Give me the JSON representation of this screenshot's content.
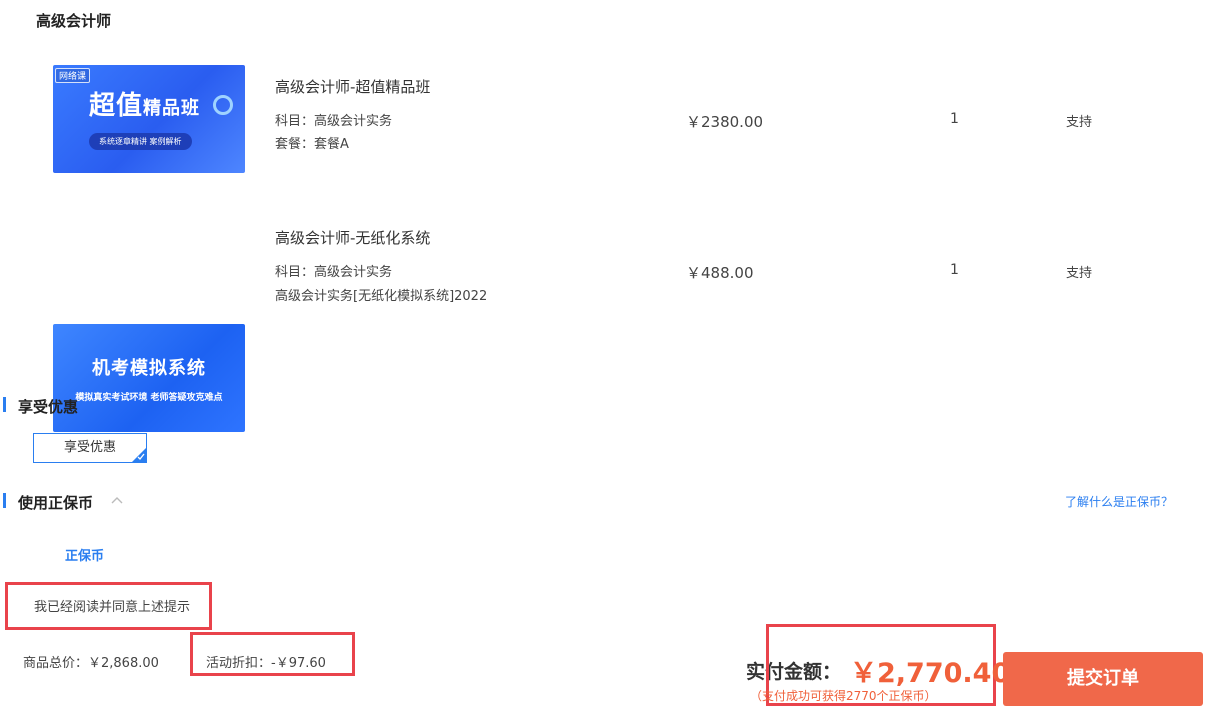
{
  "category": {
    "title": "高级会计师"
  },
  "products": [
    {
      "name": "高级会计师-超值精品班",
      "meta1": "科目：高级会计实务",
      "meta2": "套餐：套餐A",
      "price": "￥2380.00",
      "qty": "1",
      "support": "支持",
      "image": {
        "badge": "网络课",
        "title_big": "超值",
        "title_small": "精品班",
        "subtitle": "系统逐章精讲 案例解析"
      }
    },
    {
      "name": "高级会计师-无纸化系统",
      "meta1": "科目：高级会计实务",
      "meta2": "高级会计实务[无纸化模拟系统]2022",
      "price": "￥488.00",
      "qty": "1",
      "support": "支持",
      "image": {
        "title": "机考模拟系统",
        "subtitle": "模拟真实考试环境 老师答疑攻克难点"
      }
    }
  ],
  "discount": {
    "section_title": "享受优惠",
    "option_label": "享受优惠"
  },
  "coins": {
    "section_title": "使用正保币",
    "help_link": "了解什么是正保币？",
    "coin_label": "正保币"
  },
  "agreement": {
    "text": "我已经阅读并同意上述提示"
  },
  "summary": {
    "total_goods": "商品总价：￥2,868.00",
    "activity_discount": "活动折扣：-￥97.60",
    "pay_label": "实付金额：",
    "pay_amount": "￥2,770.40",
    "coin_note": "（支付成功可获得2770个正保币）"
  },
  "submit": {
    "label": "提交订单"
  },
  "colors": {
    "accent": "#2a7ef0",
    "price": "#f0603a",
    "submit": "#f0684a",
    "highlight": "#e9434b"
  }
}
